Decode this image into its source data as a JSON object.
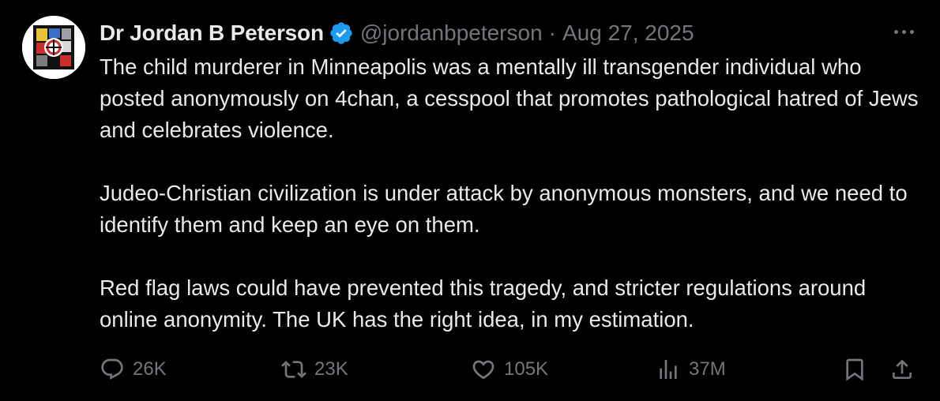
{
  "author": {
    "display_name": "Dr Jordan B Peterson",
    "handle": "@jordanbpeterson",
    "separator": "·",
    "date": "Aug 27, 2025",
    "verified_icon": "verified-badge-icon",
    "verified_color": "#1d9bf0"
  },
  "tweet": {
    "paragraphs": [
      "The child murderer in Minneapolis was a mentally ill transgender individual who posted anonymously on 4chan, a cesspool that promotes pathological hatred of Jews and celebrates violence.",
      "Judeo-Christian civilization is under attack by anonymous monsters, and we need to identify them and keep an eye on them.",
      "Red flag laws could have prevented this tragedy, and stricter regulations around online anonymity. The UK has the right idea, in my estimation."
    ]
  },
  "actions": {
    "reply": {
      "icon": "reply-icon",
      "count": "26K"
    },
    "retweet": {
      "icon": "retweet-icon",
      "count": "23K"
    },
    "like": {
      "icon": "heart-icon",
      "count": "105K"
    },
    "views": {
      "icon": "views-chart-icon",
      "count": "37M"
    },
    "bookmark": {
      "icon": "bookmark-icon"
    },
    "share": {
      "icon": "share-icon"
    }
  },
  "colors": {
    "background": "#000000",
    "text_primary": "#e7e9ea",
    "text_secondary": "#71767b"
  }
}
